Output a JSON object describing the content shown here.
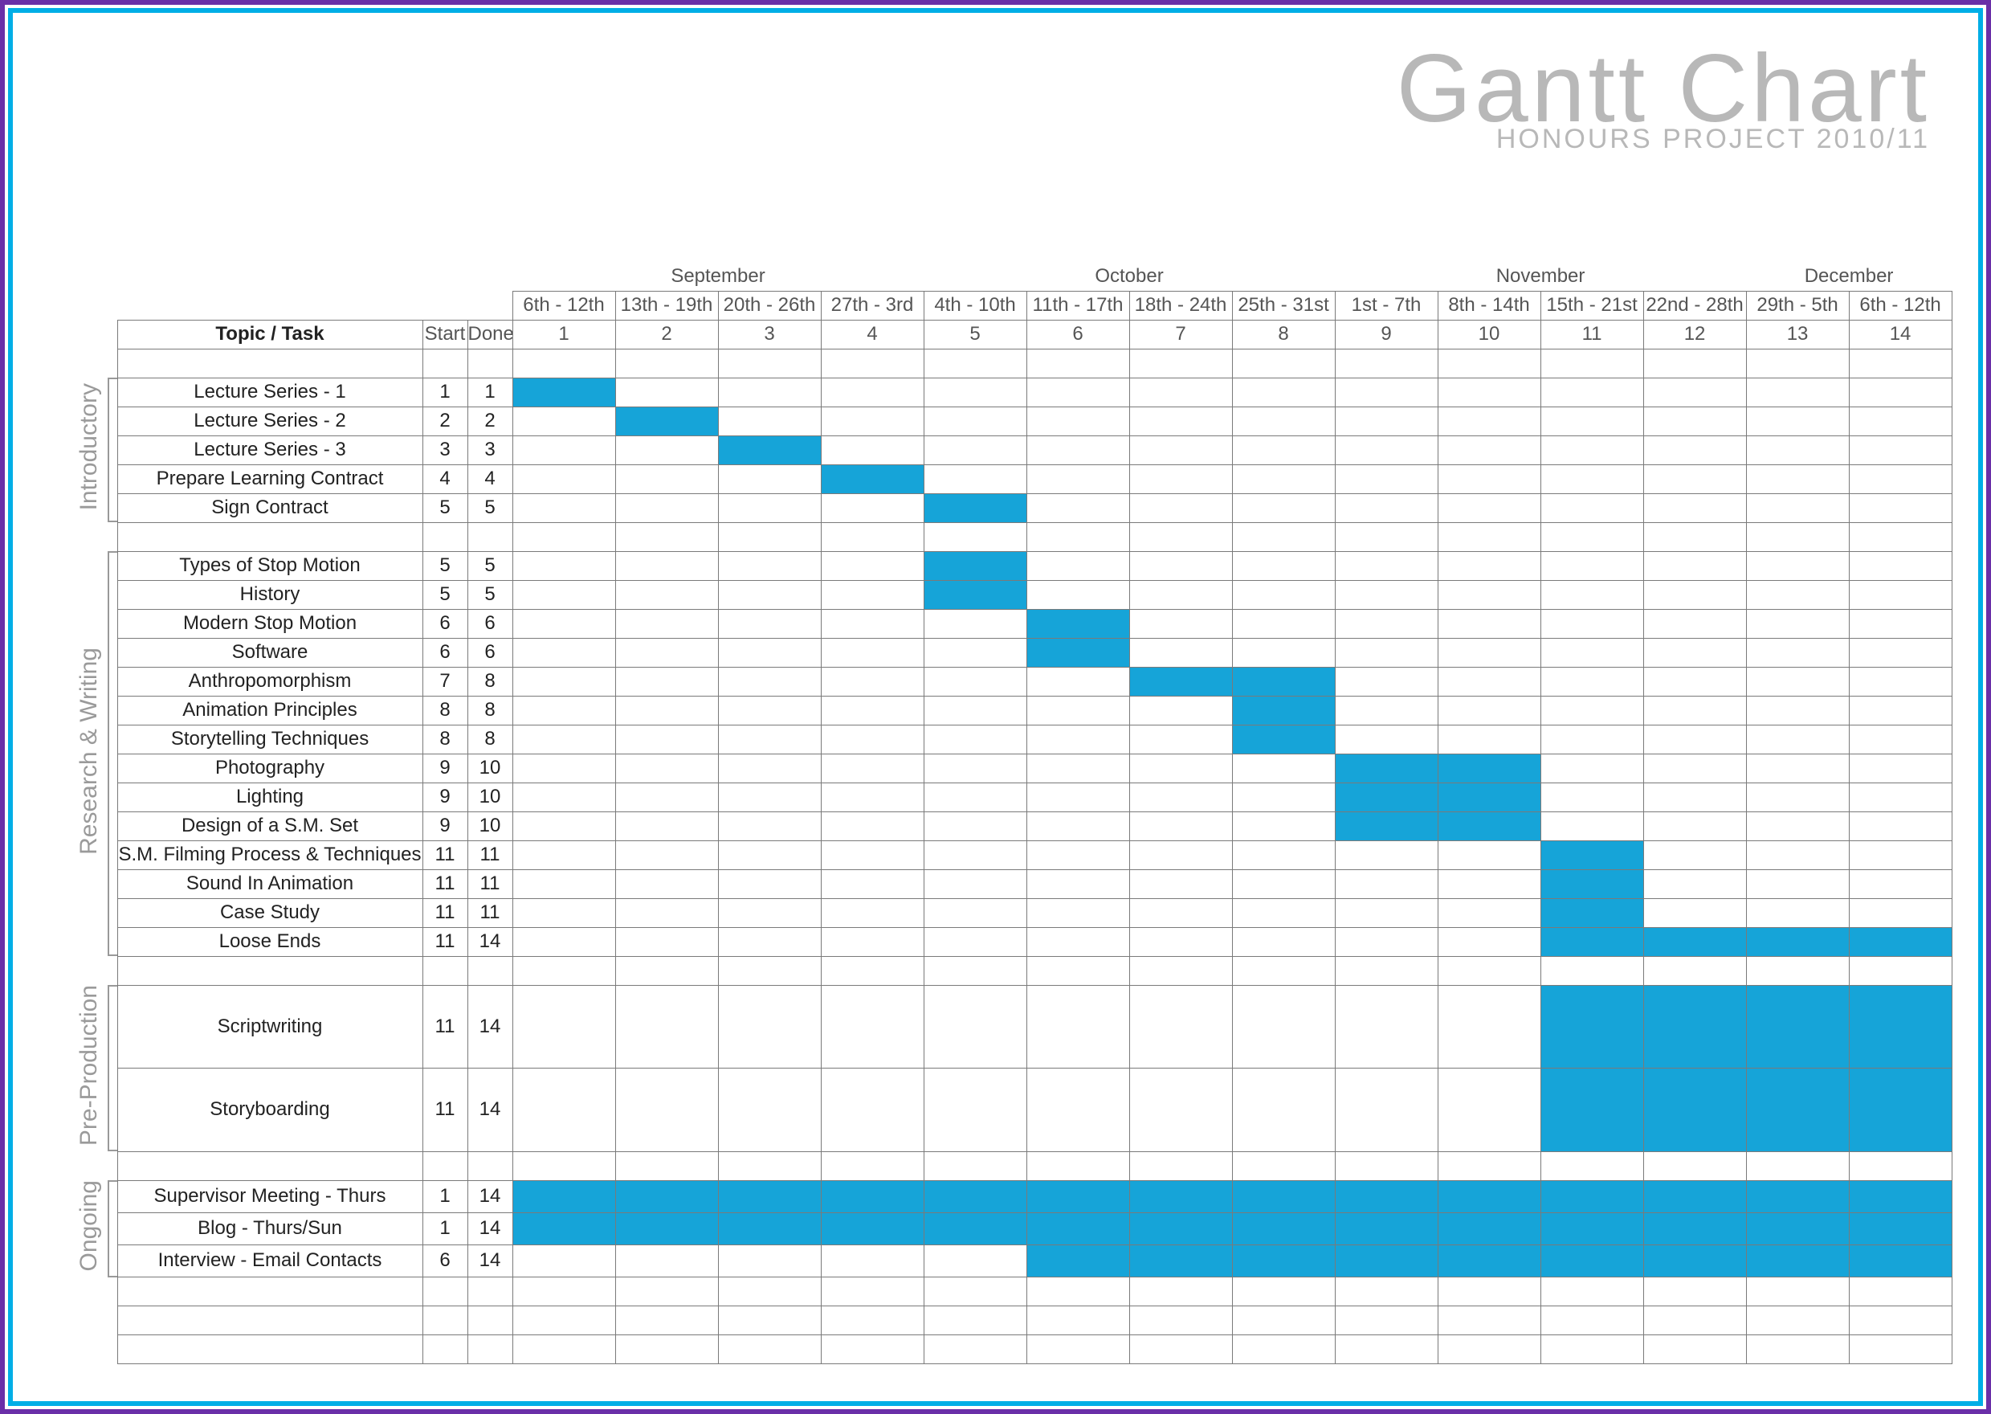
{
  "title": "Gantt Chart",
  "subtitle": "HONOURS PROJECT 2010/11",
  "header": {
    "task_col": "Topic / Task",
    "start_col": "Start",
    "done_col": "Done"
  },
  "months": [
    {
      "name": "September",
      "weeks": 4
    },
    {
      "name": "October",
      "weeks": 4
    },
    {
      "name": "November",
      "weeks": 4
    },
    {
      "name": "December",
      "weeks": 2
    }
  ],
  "week_dates": [
    "6th - 12th",
    "13th - 19th",
    "20th - 26th",
    "27th - 3rd",
    "4th - 10th",
    "11th - 17th",
    "18th - 24th",
    "25th - 31st",
    "1st - 7th",
    "8th - 14th",
    "15th - 21st",
    "22nd - 28th",
    "29th - 5th",
    "6th - 12th"
  ],
  "week_numbers": [
    "1",
    "2",
    "3",
    "4",
    "5",
    "6",
    "7",
    "8",
    "9",
    "10",
    "11",
    "12",
    "13",
    "14"
  ],
  "categories": [
    {
      "name": "Introductory",
      "tasks": [
        {
          "name": "Lecture Series - 1",
          "start": "1",
          "done": "1",
          "bars": [
            1
          ]
        },
        {
          "name": "Lecture Series - 2",
          "start": "2",
          "done": "2",
          "bars": [
            2
          ]
        },
        {
          "name": "Lecture Series - 3",
          "start": "3",
          "done": "3",
          "bars": [
            3
          ]
        },
        {
          "name": "Prepare Learning Contract",
          "start": "4",
          "done": "4",
          "bars": [
            4
          ]
        },
        {
          "name": "Sign Contract",
          "start": "5",
          "done": "5",
          "bars": [
            5
          ]
        }
      ]
    },
    {
      "name": "Research & Writing",
      "tasks": [
        {
          "name": "Types of Stop Motion",
          "start": "5",
          "done": "5",
          "bars": [
            5
          ]
        },
        {
          "name": "History",
          "start": "5",
          "done": "5",
          "bars": [
            5
          ]
        },
        {
          "name": "Modern Stop Motion",
          "start": "6",
          "done": "6",
          "bars": [
            6
          ]
        },
        {
          "name": "Software",
          "start": "6",
          "done": "6",
          "bars": [
            6
          ]
        },
        {
          "name": "Anthropomorphism",
          "start": "7",
          "done": "8",
          "bars": [
            7,
            8
          ]
        },
        {
          "name": "Animation Principles",
          "start": "8",
          "done": "8",
          "bars": [
            8
          ]
        },
        {
          "name": "Storytelling Techniques",
          "start": "8",
          "done": "8",
          "bars": [
            8
          ]
        },
        {
          "name": "Photography",
          "start": "9",
          "done": "10",
          "bars": [
            9,
            10
          ]
        },
        {
          "name": "Lighting",
          "start": "9",
          "done": "10",
          "bars": [
            9,
            10
          ]
        },
        {
          "name": "Design of a S.M. Set",
          "start": "9",
          "done": "10",
          "bars": [
            9,
            10
          ]
        },
        {
          "name": "S.M. Filming Process & Techniques",
          "start": "11",
          "done": "11",
          "bars": [
            11
          ]
        },
        {
          "name": "Sound In Animation",
          "start": "11",
          "done": "11",
          "bars": [
            11
          ]
        },
        {
          "name": "Case Study",
          "start": "11",
          "done": "11",
          "bars": [
            11
          ]
        },
        {
          "name": "Loose Ends",
          "start": "11",
          "done": "14",
          "bars": [
            11,
            12,
            13,
            14
          ]
        }
      ]
    },
    {
      "name": "Pre-Production",
      "tasks": [
        {
          "name": "Scriptwriting",
          "start": "11",
          "done": "14",
          "bars": [
            11,
            12,
            13,
            14
          ]
        },
        {
          "name": "Storyboarding",
          "start": "11",
          "done": "14",
          "bars": [
            11,
            12,
            13,
            14
          ]
        }
      ]
    },
    {
      "name": "Ongoing",
      "tasks": [
        {
          "name": "Supervisor Meeting - Thurs",
          "start": "1",
          "done": "14",
          "bars": [
            1,
            2,
            3,
            4,
            5,
            6,
            7,
            8,
            9,
            10,
            11,
            12,
            13,
            14
          ]
        },
        {
          "name": "Blog - Thurs/Sun",
          "start": "1",
          "done": "14",
          "bars": [
            1,
            2,
            3,
            4,
            5,
            6,
            7,
            8,
            9,
            10,
            11,
            12,
            13,
            14
          ]
        },
        {
          "name": "Interview - Email Contacts",
          "start": "6",
          "done": "14",
          "bars": [
            6,
            7,
            8,
            9,
            10,
            11,
            12,
            13,
            14
          ]
        }
      ]
    }
  ],
  "chart_data": {
    "type": "gantt",
    "title": "Gantt Chart — Honours Project 2010/11",
    "x_unit": "week",
    "x_range": [
      1,
      14
    ],
    "x_dates": [
      "6th - 12th Sep",
      "13th - 19th Sep",
      "20th - 26th Sep",
      "27th Sep - 3rd Oct",
      "4th - 10th Oct",
      "11th - 17th Oct",
      "18th - 24th Oct",
      "25th - 31st Oct",
      "1st - 7th Nov",
      "8th - 14th Nov",
      "15th - 21st Nov",
      "22nd - 28th Nov",
      "29th Nov - 5th Dec",
      "6th - 12th Dec"
    ],
    "groups": [
      {
        "group": "Introductory",
        "tasks": [
          {
            "task": "Lecture Series - 1",
            "start_week": 1,
            "end_week": 1
          },
          {
            "task": "Lecture Series - 2",
            "start_week": 2,
            "end_week": 2
          },
          {
            "task": "Lecture Series - 3",
            "start_week": 3,
            "end_week": 3
          },
          {
            "task": "Prepare Learning Contract",
            "start_week": 4,
            "end_week": 4
          },
          {
            "task": "Sign Contract",
            "start_week": 5,
            "end_week": 5
          }
        ]
      },
      {
        "group": "Research & Writing",
        "tasks": [
          {
            "task": "Types of Stop Motion",
            "start_week": 5,
            "end_week": 5
          },
          {
            "task": "History",
            "start_week": 5,
            "end_week": 5
          },
          {
            "task": "Modern Stop Motion",
            "start_week": 6,
            "end_week": 6
          },
          {
            "task": "Software",
            "start_week": 6,
            "end_week": 6
          },
          {
            "task": "Anthropomorphism",
            "start_week": 7,
            "end_week": 8
          },
          {
            "task": "Animation Principles",
            "start_week": 8,
            "end_week": 8
          },
          {
            "task": "Storytelling Techniques",
            "start_week": 8,
            "end_week": 8
          },
          {
            "task": "Photography",
            "start_week": 9,
            "end_week": 10
          },
          {
            "task": "Lighting",
            "start_week": 9,
            "end_week": 10
          },
          {
            "task": "Design of a S.M. Set",
            "start_week": 9,
            "end_week": 10
          },
          {
            "task": "S.M. Filming Process & Techniques",
            "start_week": 11,
            "end_week": 11
          },
          {
            "task": "Sound In Animation",
            "start_week": 11,
            "end_week": 11
          },
          {
            "task": "Case Study",
            "start_week": 11,
            "end_week": 11
          },
          {
            "task": "Loose Ends",
            "start_week": 11,
            "end_week": 14
          }
        ]
      },
      {
        "group": "Pre-Production",
        "tasks": [
          {
            "task": "Scriptwriting",
            "start_week": 11,
            "end_week": 14
          },
          {
            "task": "Storyboarding",
            "start_week": 11,
            "end_week": 14
          }
        ]
      },
      {
        "group": "Ongoing",
        "tasks": [
          {
            "task": "Supervisor Meeting - Thurs",
            "start_week": 1,
            "end_week": 14
          },
          {
            "task": "Blog - Thurs/Sun",
            "start_week": 1,
            "end_week": 14
          },
          {
            "task": "Interview - Email Contacts",
            "start_week": 6,
            "end_week": 14
          }
        ]
      }
    ]
  }
}
